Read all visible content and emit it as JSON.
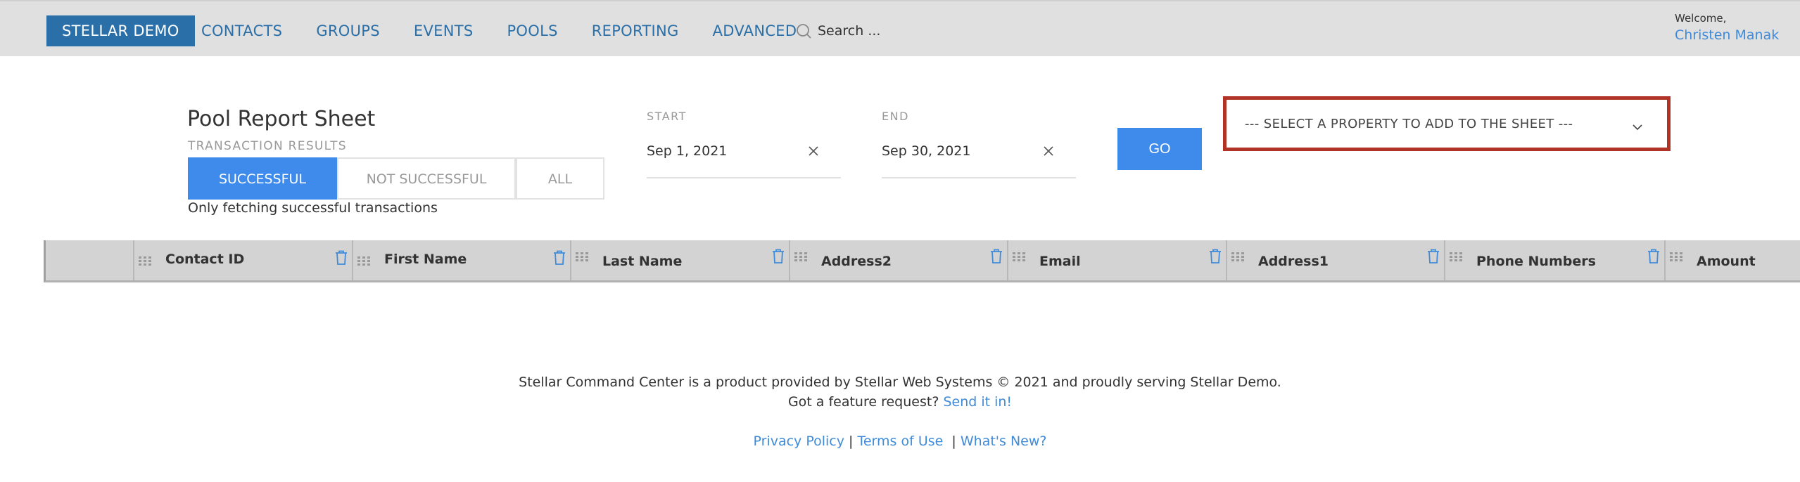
{
  "nav": {
    "brand": "STELLAR DEMO",
    "links": [
      "CONTACTS",
      "GROUPS",
      "EVENTS",
      "POOLS",
      "REPORTING",
      "ADVANCED"
    ],
    "search_placeholder": "Search ...",
    "welcome_label": "Welcome,",
    "user_name": "Christen Manak"
  },
  "report": {
    "title": "Pool Report Sheet",
    "subtitle": "TRANSACTION RESULTS",
    "filters": [
      "SUCCESSFUL",
      "NOT SUCCESSFUL",
      "ALL"
    ],
    "active_filter": "SUCCESSFUL",
    "filter_note": "Only fetching successful transactions",
    "start_label": "START",
    "start_value": "Sep 1, 2021",
    "end_label": "END",
    "end_value": "Sep 30, 2021",
    "go_label": "GO",
    "property_select": "--- SELECT A PROPERTY TO ADD TO THE SHEET ---"
  },
  "table": {
    "columns": [
      "Contact ID",
      "First Name",
      "Last Name",
      "Address2",
      "Email",
      "Address1",
      "Phone Numbers",
      "Amount"
    ]
  },
  "footer": {
    "line1": "Stellar Command Center is a product provided by Stellar Web Systems © 2021 and proudly serving Stellar Demo.",
    "line2_text": "Got a feature request?",
    "line2_link": "Send it in!",
    "privacy": "Privacy Policy",
    "terms": "Terms of Use",
    "whats_new": "What's New?"
  },
  "colors": {
    "brand": "#2a6fa8",
    "accent": "#3f8bec",
    "highlight_border": "#b03426"
  }
}
